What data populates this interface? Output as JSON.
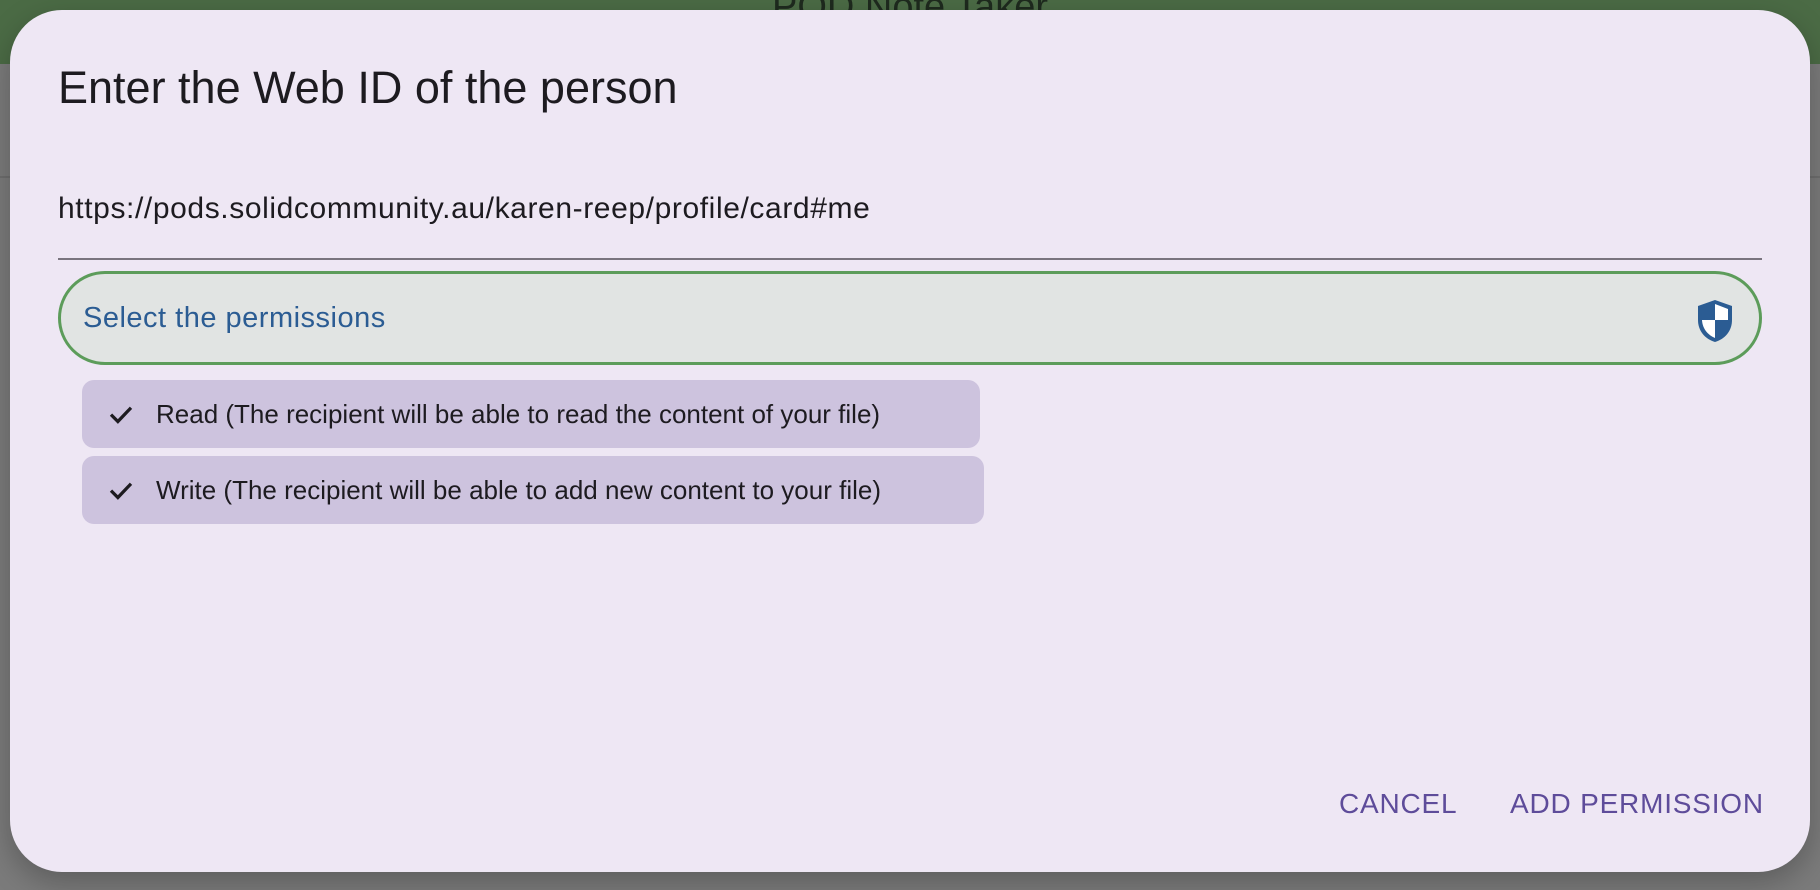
{
  "background_app": {
    "title": "POD Note Taker"
  },
  "dialog": {
    "title": "Enter the Web ID of the person",
    "webid_value": "https://pods.solidcommunity.au/karen-reep/profile/card#me",
    "permissions_placeholder": "Select the permissions",
    "permissions_icon": "shield-icon",
    "permissions": [
      {
        "label": "Read (The recipient will be able to read the content of your file)",
        "selected": true
      },
      {
        "label": "Write (The recipient will be able to add new content to your file)",
        "selected": true
      }
    ],
    "actions": {
      "cancel": "CANCEL",
      "add_permission": "ADD PERMISSION"
    }
  },
  "colors": {
    "dialog_bg": "#eee7f4",
    "select_border": "#5c9c5a",
    "placeholder": "#2b5c93",
    "chip_bg": "#cdc3de",
    "button_text": "#5e4c9a",
    "appbar": "#4b6b45"
  }
}
